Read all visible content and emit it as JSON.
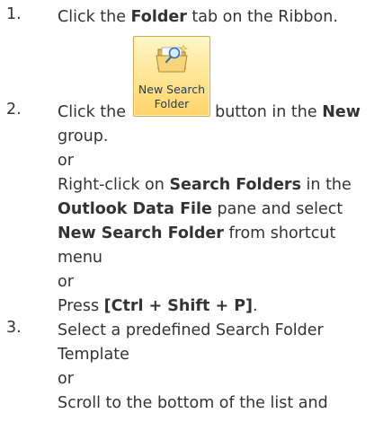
{
  "steps": [
    {
      "number": "1.",
      "lines": [
        {
          "pre": "Click the ",
          "bold": "Folder",
          "post": " tab on the Ribbon."
        }
      ]
    },
    {
      "number": "2.",
      "lines": [
        {
          "pre": "Click the ",
          "mid": " button in the ",
          "bold": "New"
        },
        {
          "text": "group."
        },
        {
          "text": "or"
        },
        {
          "pre": "Right-click on ",
          "bold": "Search Folders",
          "post": " in the"
        },
        {
          "bold": "Outlook Data File",
          "post": " pane and select"
        },
        {
          "bold": "New Search Folder",
          "post": " from shortcut"
        },
        {
          "text": "menu"
        },
        {
          "text": "or"
        },
        {
          "pre": "Press ",
          "bold": "[Ctrl + Shift + P]",
          "post": "."
        }
      ]
    },
    {
      "number": "3.",
      "lines": [
        {
          "text": "Select a predefined Search Folder"
        },
        {
          "text": "Template"
        },
        {
          "text": "or"
        },
        {
          "text": "Scroll to the bottom of the list and"
        }
      ]
    }
  ],
  "ribbon_button": {
    "line1": "New Search",
    "line2": "Folder",
    "icon": "new-search-folder-icon"
  }
}
